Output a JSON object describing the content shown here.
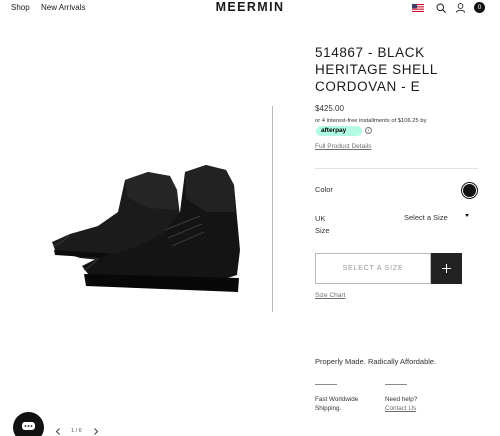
{
  "header": {
    "nav": [
      "Shop",
      "New Arrivals"
    ],
    "logo": "MEERMIN",
    "icons": [
      "us-flag-icon",
      "search-icon",
      "account-icon",
      "cart-icon"
    ],
    "cart_count": "0"
  },
  "product": {
    "title": "514867 - BLACK HERITAGE SHELL CORDOVAN - E",
    "price": "$425.00",
    "installments_text": "or 4 interest-free installments of $106.25 by",
    "afterpay_label": "afterpay",
    "full_details_link": "Full Product Details",
    "color_label": "Color",
    "color_value": "#111111",
    "size_label_line1": "UK",
    "size_label_line2": "Size",
    "size_select": "Select a Size",
    "select_size_button": "SELECT A SIZE",
    "size_chart_link": "Size Chart",
    "tagline": "Properly Made. Radically Affordable.",
    "features": [
      {
        "line1": "Fast Worldwide",
        "line2": "Shipping."
      },
      {
        "line1": "Need help?",
        "line2": "Contact Us"
      }
    ]
  },
  "gallery": {
    "pager_text": "1 / 6"
  },
  "colors": {
    "accent": "#111111",
    "afterpay": "#b2fce4",
    "divider": "#bdb7b0"
  }
}
